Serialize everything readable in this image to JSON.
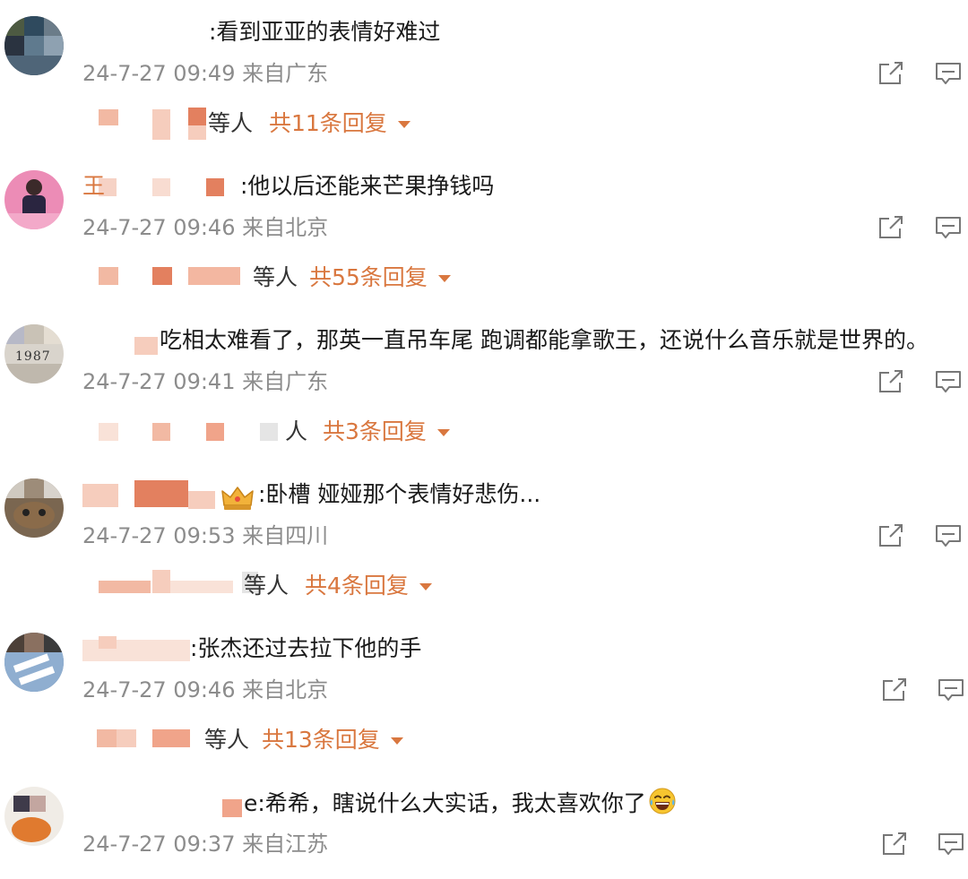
{
  "comments": [
    {
      "text": ":看到亚亚的表情好难过",
      "time": "24-7-27 09:49",
      "location": "来自广东",
      "replies": {
        "suffix": "等人",
        "count_label": "共11条回复"
      }
    },
    {
      "text": ":他以后还能来芒果挣钱吗",
      "name_fragment": "王",
      "time": "24-7-27 09:46",
      "location": "来自北京",
      "replies": {
        "suffix": "等人",
        "count_label": "共55条回复"
      }
    },
    {
      "text": "吃相太难看了，那英一直吊车尾 跑调都能拿歌王，还说什么音乐就是世界的。",
      "avatar_label": "1987",
      "time": "24-7-27 09:41",
      "location": "来自广东",
      "replies": {
        "suffix": "人",
        "count_label": "共3条回复"
      }
    },
    {
      "text": ":卧槽 娅娅那个表情好悲伤...",
      "time": "24-7-27 09:53",
      "location": "来自四川",
      "replies": {
        "suffix": "等人",
        "count_label": "共4条回复"
      }
    },
    {
      "text": ":张杰还过去拉下他的手",
      "time": "24-7-27 09:46",
      "location": "来自北京",
      "replies": {
        "suffix": "等人",
        "count_label": "共13条回复"
      }
    },
    {
      "text": "e:希希，瞎说什么大实话，我太喜欢你了",
      "emoji": "grinning-tears-emoji",
      "time": "24-7-27 09:37",
      "location": "来自江苏"
    }
  ],
  "icons": {
    "share": "share-icon",
    "reply": "comment-reply-icon",
    "caret": "caret-down-icon",
    "crown": "crown-badge-icon"
  },
  "colors": {
    "accent": "#d9773f",
    "meta": "#8c8c8c",
    "mosaic": "#e8957a"
  }
}
